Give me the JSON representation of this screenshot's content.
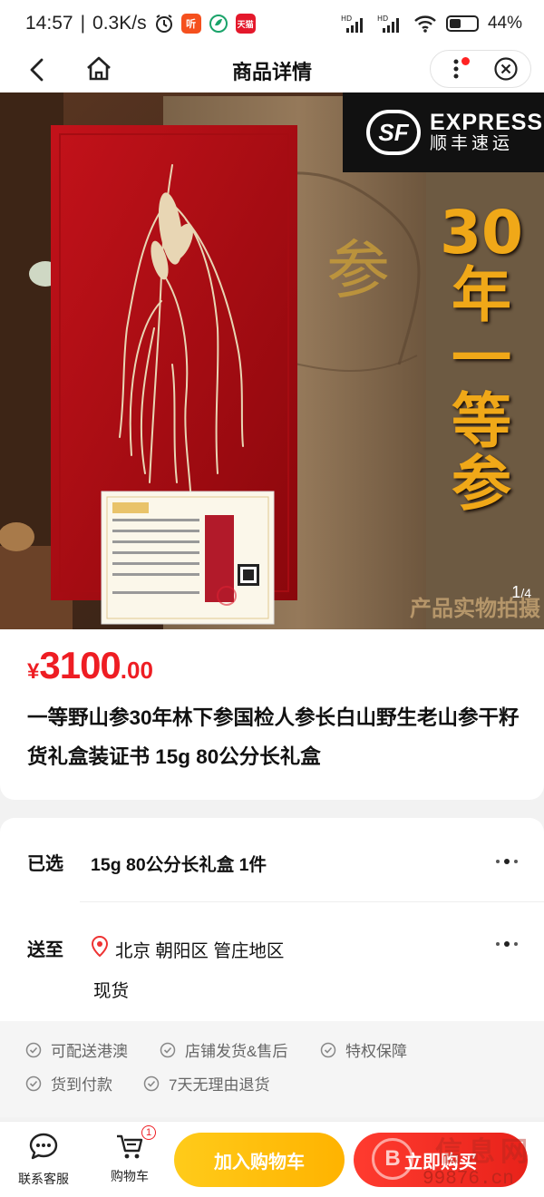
{
  "status_bar": {
    "time": "14:57",
    "speed": "0.3K/s",
    "app_icons": [
      "听",
      "天猫"
    ],
    "battery": "44%",
    "battery_level": 0.44
  },
  "nav": {
    "title": "商品详情"
  },
  "product_image": {
    "sf_en": "EXPRESS",
    "sf_cn": "顺丰速运",
    "sf_logo": "SF",
    "vertical_text": [
      "30",
      "年",
      "一",
      "等",
      "参"
    ],
    "footer_text": "产品实物拍摄",
    "counter_current": "1",
    "counter_total": "/4"
  },
  "price": {
    "symbol": "¥",
    "integer": "3100",
    "decimal": ".00"
  },
  "title": "一等野山参30年林下参国检人参长白山野生老山参干籽货礼盒装证书 15g 80公分长礼盒",
  "options": {
    "selected_label": "已选",
    "selected_value": "15g 80公分长礼盒 1件",
    "ship_label": "送至",
    "ship_address": "北京  朝阳区  管庄地区",
    "stock": "现货"
  },
  "guarantees": [
    "可配送港澳",
    "店铺发货&售后",
    "特权保障",
    "货到付款",
    "7天无理由退货"
  ],
  "bottom_bar": {
    "service_label": "联系客服",
    "cart_label": "购物车",
    "cart_badge": "1",
    "add_cart": "加入购物车",
    "buy_now": "立即购买",
    "watermark_cn": "信息网",
    "watermark_url": "99876.cn",
    "watermark_logo": "B"
  },
  "colors": {
    "price_red": "#ee1d23",
    "cart_yellow": "#ffb300",
    "buy_red": "#e8221a",
    "sf_gold": "#f0a818"
  }
}
